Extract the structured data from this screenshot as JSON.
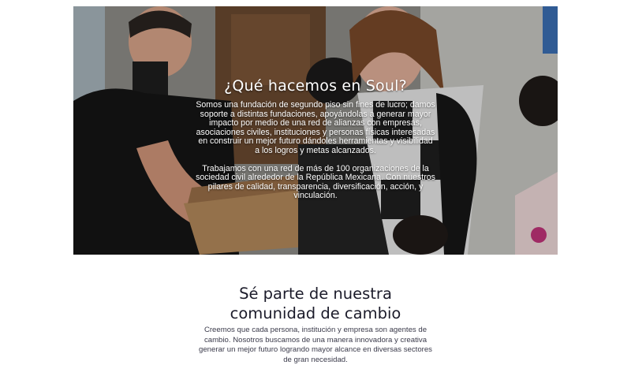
{
  "hero": {
    "title": "¿Qué hacemos en Soul?",
    "paragraph_1": "Somos una fundación de segundo piso sin fines de lucro; damos soporte a distintas fundaciones, apoyándolas a generar mayor impacto por medio de una red de alianzas con empresas, asociaciones civiles, instituciones y personas físicas interesadas en construir un mejor futuro dándoles herramientas y visibilidad a los logros y metas alcanzados.",
    "paragraph_2": "Trabajamos con una red de más de 100 organizaciones de la sociedad civil alrededor de la República Mexicana. Con nuestros pilares de calidad, transparencia, diversificación, acción, y vinculación."
  },
  "cta": {
    "title_line1": "Sé parte de nuestra",
    "title_highlight": "comunidad",
    "title_rest": " de cambio",
    "description": "Creemos que cada persona, institución y empresa son agentes de cambio. Nosotros buscamos de una manera innovadora y creativa generar un mejor futuro logrando mayor alcance en diversas sectores de gran necesidad."
  },
  "colors": {
    "highlight": "#5b8fd6",
    "text_dark": "#1b1b2a"
  }
}
